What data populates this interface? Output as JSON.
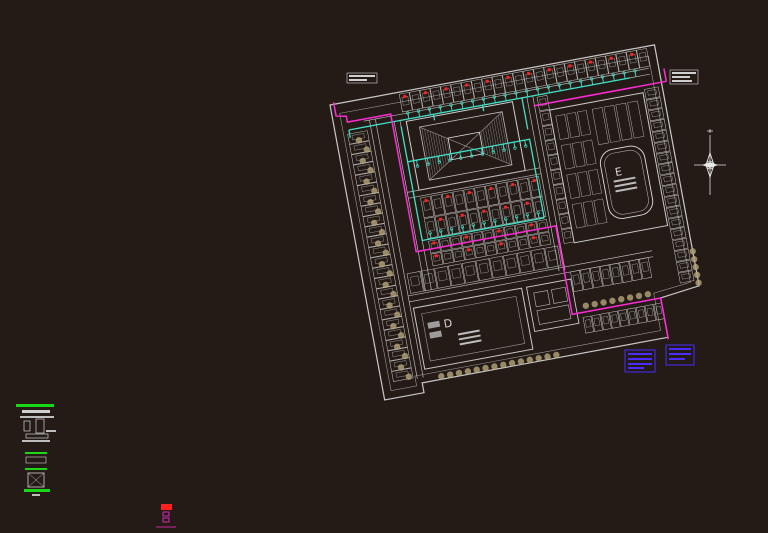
{
  "drawing": {
    "block_d_label": "D",
    "block_e_label": "E"
  },
  "colors": {
    "background": "#241b17",
    "linework": "#c9c9c9",
    "water_line": "#40e0c8",
    "boundary_line": "#ff2bd6",
    "lot_marker": "#ff2020",
    "tree": "#b5a57a",
    "legend_box": "#4a2cff",
    "legend_header": "#18d818"
  },
  "icons": {
    "north_arrow": "north-arrow-icon",
    "tree_symbol": "tree-icon"
  }
}
